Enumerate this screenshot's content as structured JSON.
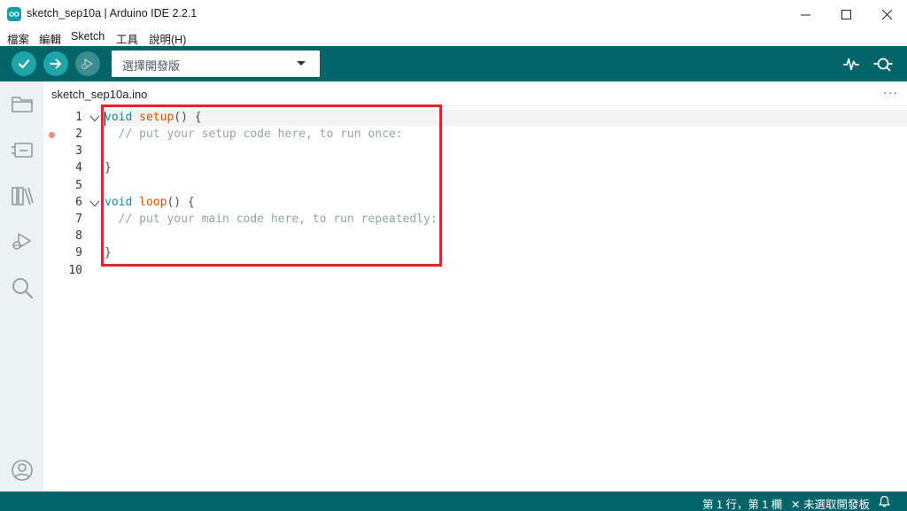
{
  "window": {
    "title": "sketch_sep10a | Arduino IDE 2.2.1"
  },
  "menu": [
    {
      "label": "檔案"
    },
    {
      "label": "編輯"
    },
    {
      "label": "Sketch"
    },
    {
      "label": "工具"
    },
    {
      "label": "說明(H)"
    }
  ],
  "toolbar": {
    "board_select_label": "選擇開發版",
    "icons": [
      "verify-icon",
      "upload-icon",
      "debug-icon",
      "serial-plotter-icon",
      "serial-monitor-icon"
    ]
  },
  "sidebar": {
    "icons": [
      "sketchbook-folder-icon",
      "boards-manager-icon",
      "library-manager-icon",
      "debug-icon",
      "search-icon",
      "profile-icon"
    ]
  },
  "tab": {
    "label": "sketch_sep10a.ino",
    "more": "···"
  },
  "editor": {
    "lines": [
      {
        "num": "1",
        "a": "void",
        "b": " ",
        "c": "setup",
        "d": "() {"
      },
      {
        "num": "2",
        "comment": "  // put your setup code here, to run once:"
      },
      {
        "num": "3"
      },
      {
        "num": "4",
        "text": "}"
      },
      {
        "num": "5"
      },
      {
        "num": "6",
        "a": "void",
        "b": " ",
        "c": "loop",
        "d": "() {"
      },
      {
        "num": "7",
        "comment": "  // put your main code here, to run repeatedly:"
      },
      {
        "num": "8"
      },
      {
        "num": "9",
        "text": "}"
      },
      {
        "num": "10"
      }
    ]
  },
  "status": {
    "position": "第 1 行，第 1 欄",
    "board": "✕ 未選取開發板"
  },
  "colors": {
    "teal": "#006468",
    "keyword": "#00979d",
    "function": "#d35400",
    "comment": "#95a5a6",
    "highlight": "#e3242b"
  }
}
